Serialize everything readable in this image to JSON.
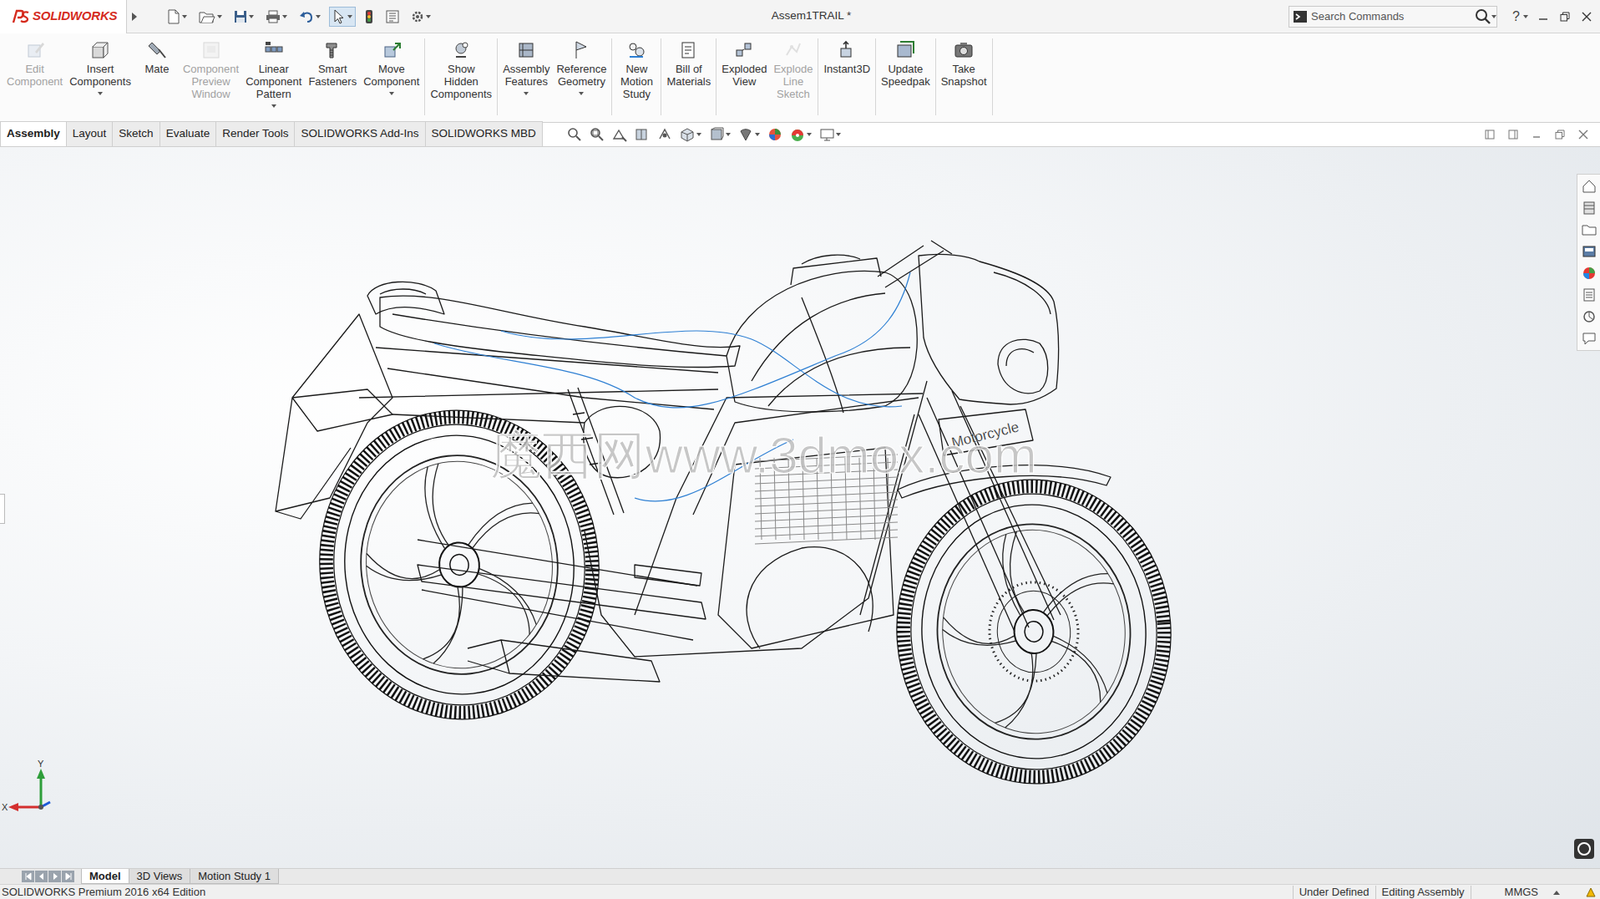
{
  "app": {
    "logo": "SOLIDWORKS",
    "title": "Assem1TRAIL *",
    "search_placeholder": "Search Commands",
    "help": "?"
  },
  "tools": {
    "select_active": true
  },
  "ribbon": {
    "groups": [
      {
        "buttons": [
          {
            "lines": [
              "Edit",
              "Component"
            ],
            "disabled": true,
            "has_dropdown": false
          },
          {
            "lines": [
              "Insert",
              "Components"
            ],
            "disabled": false,
            "has_dropdown": true
          },
          {
            "lines": [
              "Mate"
            ],
            "disabled": false,
            "has_dropdown": false
          },
          {
            "lines": [
              "Component",
              "Preview",
              "Window"
            ],
            "disabled": true,
            "has_dropdown": false
          },
          {
            "lines": [
              "Linear",
              "Component",
              "Pattern"
            ],
            "disabled": false,
            "has_dropdown": true
          },
          {
            "lines": [
              "Smart",
              "Fasteners"
            ],
            "disabled": false,
            "has_dropdown": false
          },
          {
            "lines": [
              "Move",
              "Component"
            ],
            "disabled": false,
            "has_dropdown": true
          }
        ]
      },
      {
        "buttons": [
          {
            "lines": [
              "Show",
              "Hidden",
              "Components"
            ],
            "disabled": false,
            "has_dropdown": false
          }
        ]
      },
      {
        "buttons": [
          {
            "lines": [
              "Assembly",
              "Features"
            ],
            "disabled": false,
            "has_dropdown": true
          },
          {
            "lines": [
              "Reference",
              "Geometry"
            ],
            "disabled": false,
            "has_dropdown": true
          }
        ]
      },
      {
        "buttons": [
          {
            "lines": [
              "New",
              "Motion",
              "Study"
            ],
            "disabled": false,
            "has_dropdown": false
          }
        ]
      },
      {
        "buttons": [
          {
            "lines": [
              "Bill of",
              "Materials"
            ],
            "disabled": false,
            "has_dropdown": false
          }
        ]
      },
      {
        "buttons": [
          {
            "lines": [
              "Exploded",
              "View"
            ],
            "disabled": false,
            "has_dropdown": false
          },
          {
            "lines": [
              "Explode",
              "Line",
              "Sketch"
            ],
            "disabled": true,
            "has_dropdown": false
          }
        ]
      },
      {
        "buttons": [
          {
            "lines": [
              "Instant3D"
            ],
            "disabled": false,
            "has_dropdown": false
          }
        ]
      },
      {
        "buttons": [
          {
            "lines": [
              "Update",
              "Speedpak"
            ],
            "disabled": false,
            "has_dropdown": false
          }
        ]
      },
      {
        "buttons": [
          {
            "lines": [
              "Take",
              "Snapshot"
            ],
            "disabled": false,
            "has_dropdown": false
          }
        ]
      }
    ]
  },
  "command_tabs": [
    {
      "label": "Assembly",
      "selected": true
    },
    {
      "label": "Layout",
      "selected": false
    },
    {
      "label": "Sketch",
      "selected": false
    },
    {
      "label": "Evaluate",
      "selected": false
    },
    {
      "label": "Render Tools",
      "selected": false
    },
    {
      "label": "SOLIDWORKS Add-Ins",
      "selected": false
    },
    {
      "label": "SOLIDWORKS MBD",
      "selected": false
    }
  ],
  "viewport": {
    "watermark": "魔西网www.3dmox.com",
    "plate_label": "Motorcycle",
    "triad": {
      "y": "Y",
      "x": "X"
    }
  },
  "bottom_tabs": [
    {
      "label": "Model",
      "selected": true
    },
    {
      "label": "3D Views",
      "selected": false
    },
    {
      "label": "Motion Study 1",
      "selected": false
    }
  ],
  "status_bar": {
    "edition": "SOLIDWORKS Premium 2016 x64 Edition",
    "state": "Under Defined",
    "mode": "Editing Assembly",
    "units": "MMGS"
  }
}
